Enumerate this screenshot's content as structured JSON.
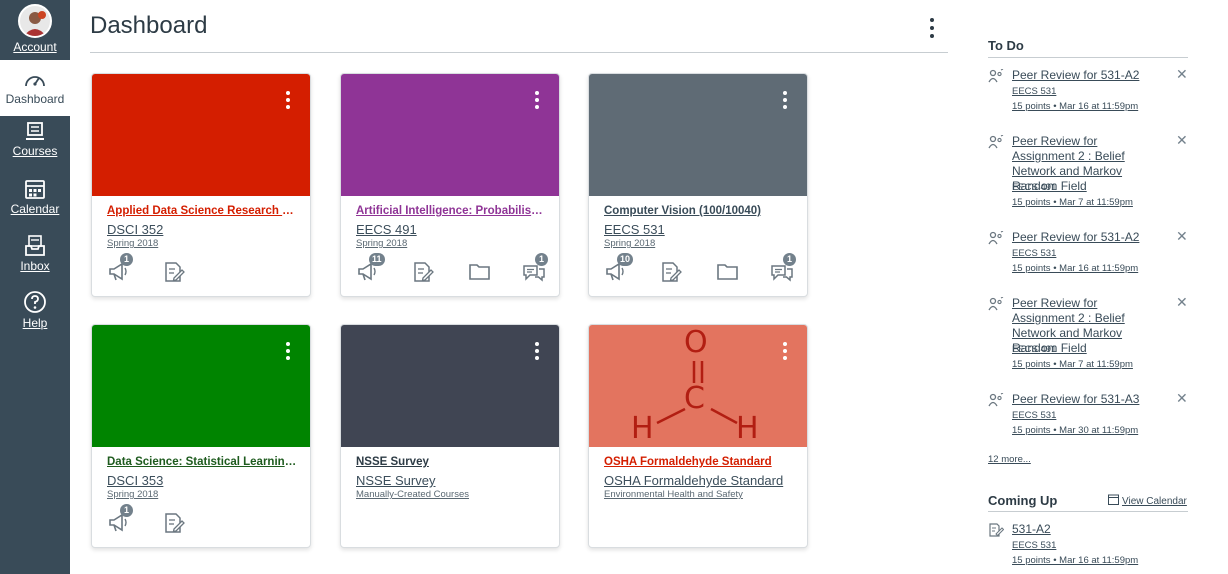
{
  "nav": {
    "account": "Account",
    "dashboard": "Dashboard",
    "courses": "Courses",
    "calendar": "Calendar",
    "inbox": "Inbox",
    "help": "Help"
  },
  "header": {
    "title": "Dashboard"
  },
  "cards": [
    {
      "name": "Applied Data Science Research (1...",
      "code": "DSCI 352",
      "term": "Spring 2018",
      "color": "#d41e00",
      "name_color": "#d41e00",
      "announcement_badge": "1",
      "discussion_badge": ""
    },
    {
      "name": "Artificial Intelligence: Probabilistic...",
      "code": "EECS 491",
      "term": "Spring 2018",
      "color": "#8f3496",
      "name_color": "#8f3496",
      "announcement_badge": "11",
      "discussion_badge": "1"
    },
    {
      "name": "Computer Vision (100/10040)",
      "code": "EECS 531",
      "term": "Spring 2018",
      "color": "#5f6b75",
      "name_color": "#394b58",
      "announcement_badge": "10",
      "discussion_badge": "1"
    },
    {
      "name": "Data Science: Statistical Learning, ...",
      "code": "DSCI 353",
      "term": "Spring 2018",
      "color": "#008400",
      "name_color": "#1e5b1e",
      "announcement_badge": "1",
      "discussion_badge": ""
    },
    {
      "name": "NSSE Survey",
      "code": "NSSE Survey",
      "term": "Manually-Created Courses",
      "color": "#404553",
      "name_color": "#2d3b45",
      "announcement_badge": "",
      "discussion_badge": ""
    },
    {
      "name": "OSHA Formaldehyde Standard",
      "code": "OSHA Formaldehyde Standard",
      "term": "Environmental Health and Safety",
      "color": "#e3745f",
      "name_color": "#d41e00",
      "announcement_badge": "",
      "discussion_badge": ""
    }
  ],
  "molecule": {
    "o": "O",
    "c": "C",
    "h1": "H",
    "h2": "H"
  },
  "todo": {
    "title": "To Do",
    "items": [
      {
        "title": "Peer Review for 531-A2",
        "course": "EECS 531",
        "meta": "15 points • Mar 16 at 11:59pm"
      },
      {
        "title": "Peer Review for Assignment 2 : Belief Network and Markov Random Field",
        "course": "EECS 491",
        "meta": "15 points • Mar 7 at 11:59pm"
      },
      {
        "title": "Peer Review for 531-A2",
        "course": "EECS 531",
        "meta": "15 points • Mar 16 at 11:59pm"
      },
      {
        "title": "Peer Review for Assignment 2 : Belief Network and Markov Random Field",
        "course": "EECS 491",
        "meta": "15 points • Mar 7 at 11:59pm"
      },
      {
        "title": "Peer Review for 531-A3",
        "course": "EECS 531",
        "meta": "15 points • Mar 30 at 11:59pm"
      }
    ],
    "close": "✕",
    "more": "12 more..."
  },
  "coming_up": {
    "title": "Coming Up",
    "view_calendar": "View Calendar",
    "items": [
      {
        "title": "531-A2",
        "course": "EECS 531",
        "meta": "15 points • Mar 16 at 11:59pm"
      }
    ]
  }
}
